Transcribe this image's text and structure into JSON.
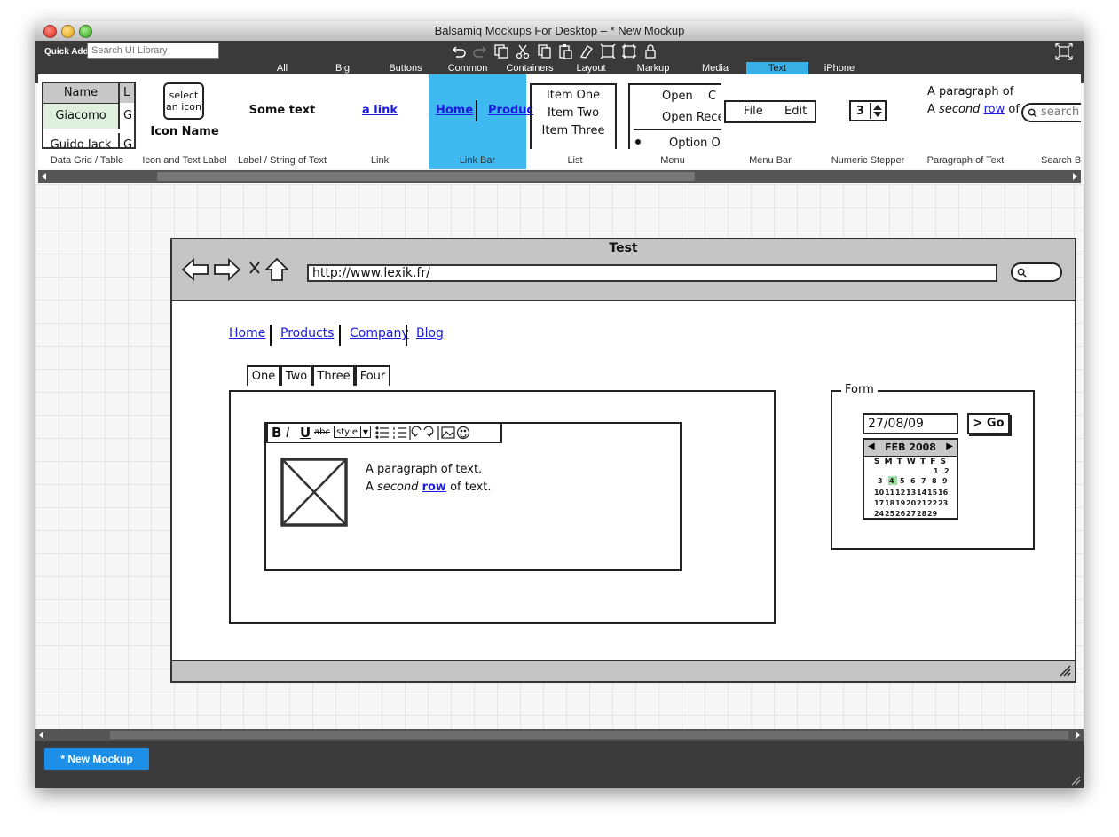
{
  "app": {
    "title": "Balsamiq Mockups For Desktop – * New Mockup"
  },
  "quick_add": {
    "label": "Quick Add:",
    "placeholder": "Search UI Library"
  },
  "categories": [
    "All",
    "Big",
    "Buttons",
    "Common",
    "Containers",
    "Layout",
    "Markup",
    "Media",
    "Text",
    "iPhone"
  ],
  "active_category": "Text",
  "library": {
    "data_grid": {
      "header1": "Name",
      "header2": "L",
      "row1": "Giacomo",
      "row2": "Guido Jack",
      "partial": "G",
      "label": "Data Grid / Table"
    },
    "icon_label": {
      "icon_text": "select an icon",
      "name": "Icon Name",
      "label": "Icon and Text Label"
    },
    "text_label": {
      "text": "Some text",
      "label": "Label / String of Text"
    },
    "link": {
      "text": "a link",
      "label": "Link"
    },
    "link_bar": {
      "home": "Home",
      "products": "Produc",
      "label": "Link Bar"
    },
    "list": {
      "items": [
        "Item One",
        "Item Two",
        "Item Three"
      ],
      "label": "List"
    },
    "menu": {
      "item1": "Open",
      "item1_key": "C",
      "item2": "Open Rece",
      "item3": "Option O",
      "label": "Menu"
    },
    "menu_bar": {
      "file": "File",
      "edit": "Edit",
      "label": "Menu Bar"
    },
    "stepper": {
      "value": "3",
      "label": "Numeric Stepper"
    },
    "paragraph": {
      "line1": "A paragraph of",
      "line2_a": "A",
      "line2_b": "second",
      "line2_c": "row",
      "line2_d": "of",
      "label": "Paragraph of Text"
    },
    "search_box": {
      "placeholder": "search",
      "label": "Search Bo"
    }
  },
  "mockup": {
    "browser_title": "Test",
    "url": "http://www.lexik.fr/",
    "nav_links": [
      "Home",
      "Products",
      "Company",
      "Blog"
    ],
    "tabs": [
      "One",
      "Two",
      "Three",
      "Four"
    ],
    "editor": {
      "style_label": "style",
      "para_line1": "A paragraph of text.",
      "para_line2_a": "A",
      "para_line2_b": "second",
      "para_line2_c": "row",
      "para_line2_d": "of text."
    },
    "form": {
      "title": "Form",
      "date_value": "27/08/09",
      "go_label": "> Go",
      "calendar_month": "FEB 2008",
      "weekdays": "S M T W T F S"
    }
  },
  "bottom_tabs": [
    "* New Mockup"
  ]
}
